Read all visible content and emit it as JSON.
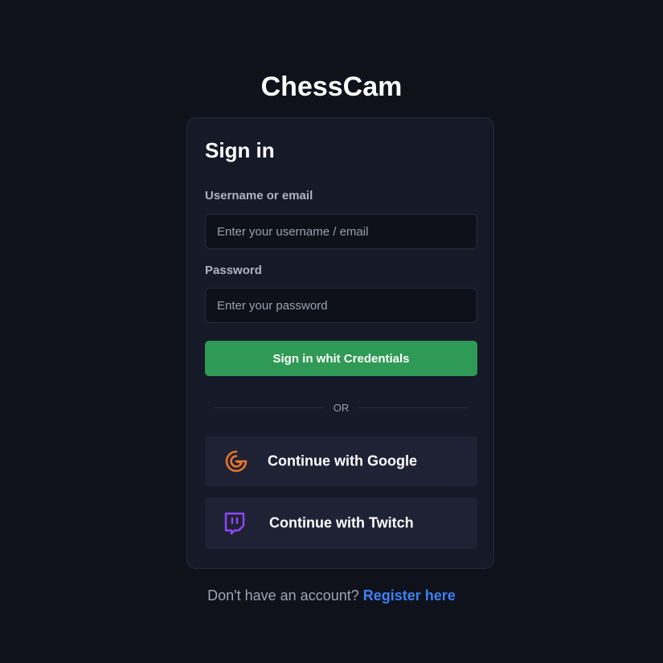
{
  "app": {
    "title": "ChessCam"
  },
  "signin": {
    "title": "Sign in",
    "username_label": "Username or email",
    "username_placeholder": "Enter your username / email",
    "username_value": "",
    "password_label": "Password",
    "password_placeholder": "Enter your password",
    "password_value": "",
    "submit_label": "Sign in whit Credentials",
    "divider_text": "OR",
    "google_label": "Continue with Google",
    "google_icon": "google-icon",
    "twitch_label": "Continue with Twitch",
    "twitch_icon": "twitch-icon"
  },
  "footer": {
    "prompt": "Don't have an account?",
    "register_label": "Register here"
  },
  "colors": {
    "background": "#0f111b",
    "card": "#161927",
    "primary_button": "#2f9a55",
    "google_icon": "#e8762c",
    "twitch_icon": "#9146ff",
    "link": "#3b82f6"
  }
}
